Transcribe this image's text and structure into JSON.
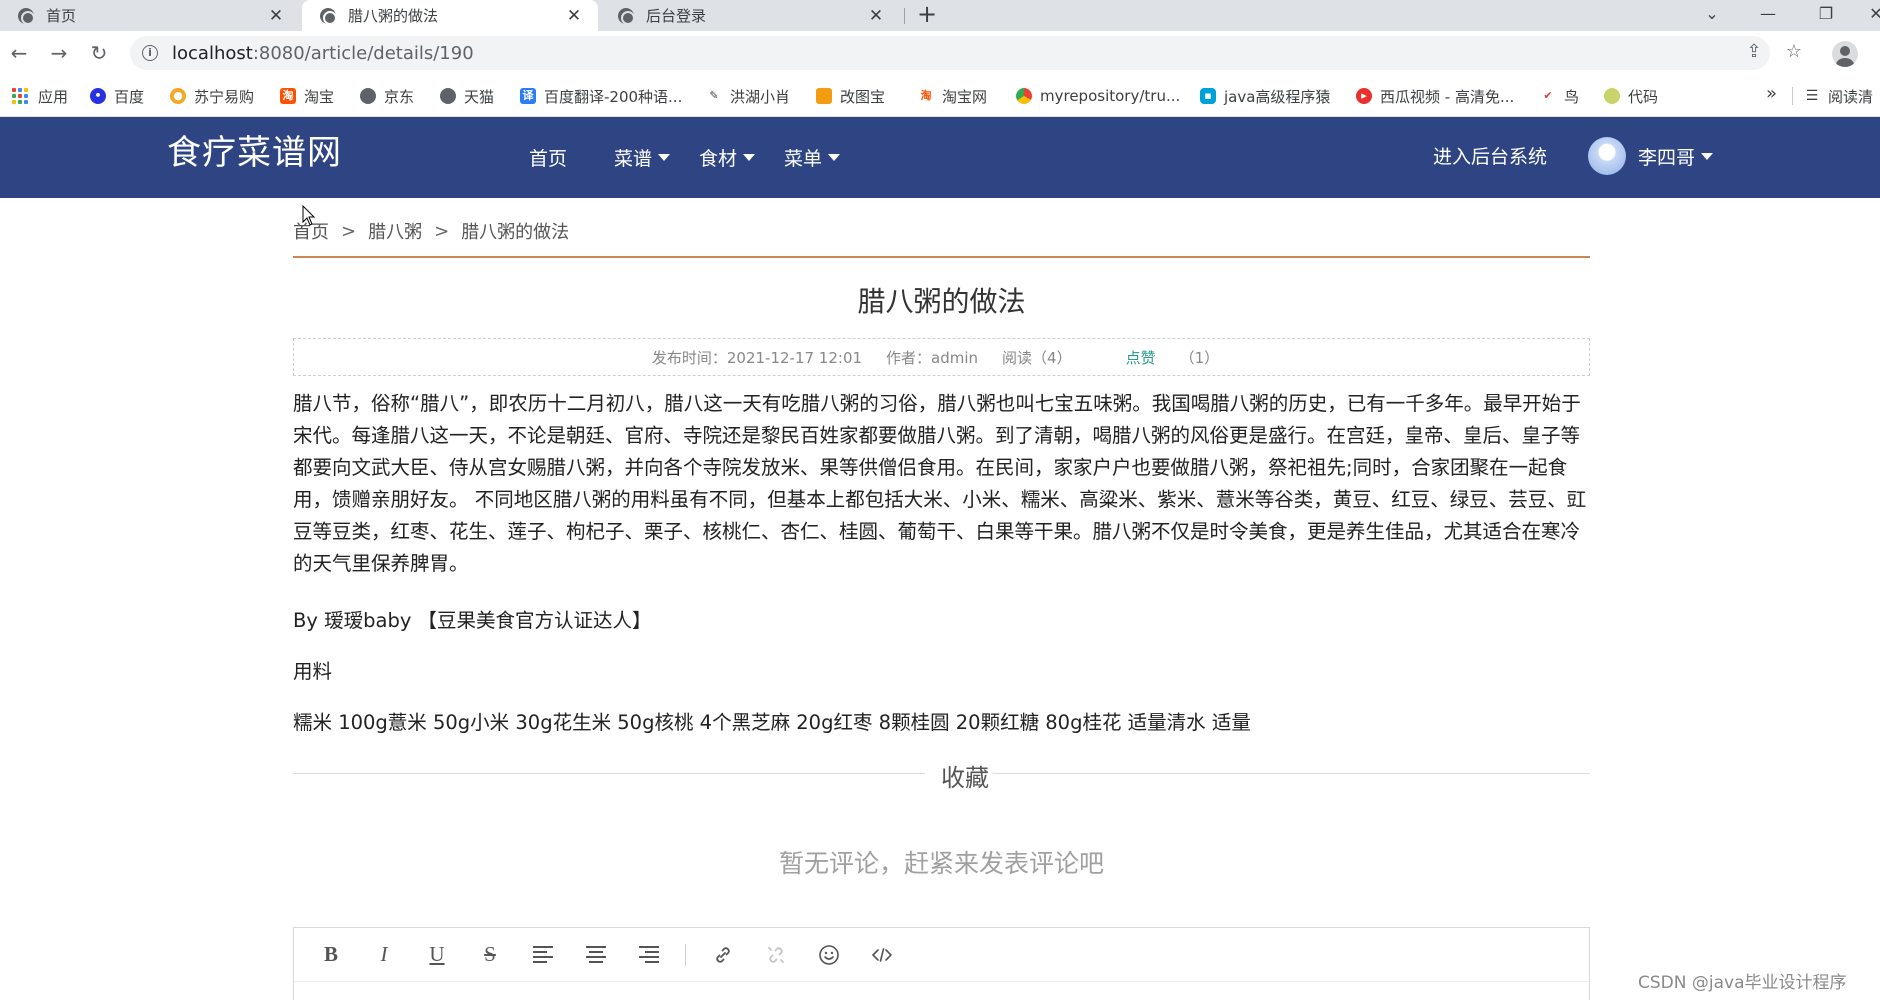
{
  "browser": {
    "tabs": [
      {
        "label": "首页",
        "active": false
      },
      {
        "label": "腊八粥的做法",
        "active": true
      },
      {
        "label": "后台登录",
        "active": false
      }
    ],
    "new_tab": "+",
    "url_host": "localhost",
    "url_path": ":8080/article/details/190",
    "bookmarks": [
      {
        "label": "应用",
        "icon": "apps-grid-icon"
      },
      {
        "label": "百度",
        "icon": "baidu-paw-icon",
        "color": "#2932e1"
      },
      {
        "label": "苏宁易购",
        "icon": "suning-icon",
        "color": "#f5a623"
      },
      {
        "label": "淘宝",
        "icon": "taobao-icon",
        "color": "#ff5000"
      },
      {
        "label": "京东",
        "icon": "globe-icon",
        "color": "#5f6368"
      },
      {
        "label": "天猫",
        "icon": "globe-icon",
        "color": "#5f6368"
      },
      {
        "label": "百度翻译-200种语...",
        "icon": "translate-icon",
        "color": "#2b7cf6"
      },
      {
        "label": "洪湖小肖",
        "icon": "feather-icon",
        "color": "#444444"
      },
      {
        "label": "改图宝",
        "icon": "gaitubao-icon",
        "color": "#f39c12"
      },
      {
        "label": "淘宝网",
        "icon": "taobao-icon",
        "color": "#ff5000"
      },
      {
        "label": "myrepository/tru...",
        "icon": "chrome-icon",
        "color": "#34a853"
      },
      {
        "label": "java高级程序猿",
        "icon": "bilibili-icon",
        "color": "#00a1d6"
      },
      {
        "label": "西瓜视频 - 高清免...",
        "icon": "xigua-icon",
        "color": "#e9302d"
      },
      {
        "label": "鸟",
        "icon": "bird-icon",
        "color": "#e53935"
      },
      {
        "label": "代码",
        "icon": "leaf-icon",
        "color": "#c8d36b"
      }
    ],
    "bookmarks_more": "»",
    "reading_list": "阅读清"
  },
  "site": {
    "logo": "食疗菜谱网",
    "nav": [
      {
        "label": "首页",
        "dropdown": false
      },
      {
        "label": "菜谱",
        "dropdown": true
      },
      {
        "label": "食材",
        "dropdown": true
      },
      {
        "label": "菜单",
        "dropdown": true
      }
    ],
    "admin_link": "进入后台系统",
    "user_name": "李四哥"
  },
  "breadcrumb": {
    "items": [
      "首页",
      "腊八粥",
      "腊八粥的做法"
    ],
    "separator": ">"
  },
  "article": {
    "title": "腊八粥的做法",
    "meta": {
      "publish": "发布时间：2021-12-17 12:01",
      "author": "作者：admin",
      "views": "阅读（4）",
      "like_label": "点赞",
      "like_count": "（1）"
    },
    "body": "腊八节，俗称“腊八”，即农历十二月初八，腊八这一天有吃腊八粥的习俗，腊八粥也叫七宝五味粥。我国喝腊八粥的历史，已有一千多年。最早开始于宋代。每逢腊八这一天，不论是朝廷、官府、寺院还是黎民百姓家都要做腊八粥。到了清朝，喝腊八粥的风俗更是盛行。在宫廷，皇帝、皇后、皇子等都要向文武大臣、侍从宫女赐腊八粥，并向各个寺院发放米、果等供僧侣食用。在民间，家家户户也要做腊八粥，祭祀祖先;同时，合家团聚在一起食用，馈赠亲朋好友。 不同地区腊八粥的用料虽有不同，但基本上都包括大米、小米、糯米、高粱米、紫米、薏米等谷类，黄豆、红豆、绿豆、芸豆、豇豆等豆类，红枣、花生、莲子、枸杞子、栗子、核桃仁、杏仁、桂圆、葡萄干、白果等干果。腊八粥不仅是时令美食，更是养生佳品，尤其适合在寒冷的天气里保养脾胃。",
    "byline": "By 瑷瑷baby 【豆果美食官方认证达人】",
    "ingredients_heading": "用料",
    "ingredients": "糯米 100g薏米 50g小米 30g花生米 50g核桃 4个黑芝麻 20g红枣 8颗桂圆 20颗红糖 80g桂花 适量清水 适量"
  },
  "favorite_label": "收藏",
  "comments": {
    "empty_text": "暂无评论，赶紧来发表评论吧"
  },
  "editor": {
    "tools": [
      "B",
      "I",
      "U",
      "S"
    ]
  },
  "watermark": "CSDN @java毕业设计程序"
}
